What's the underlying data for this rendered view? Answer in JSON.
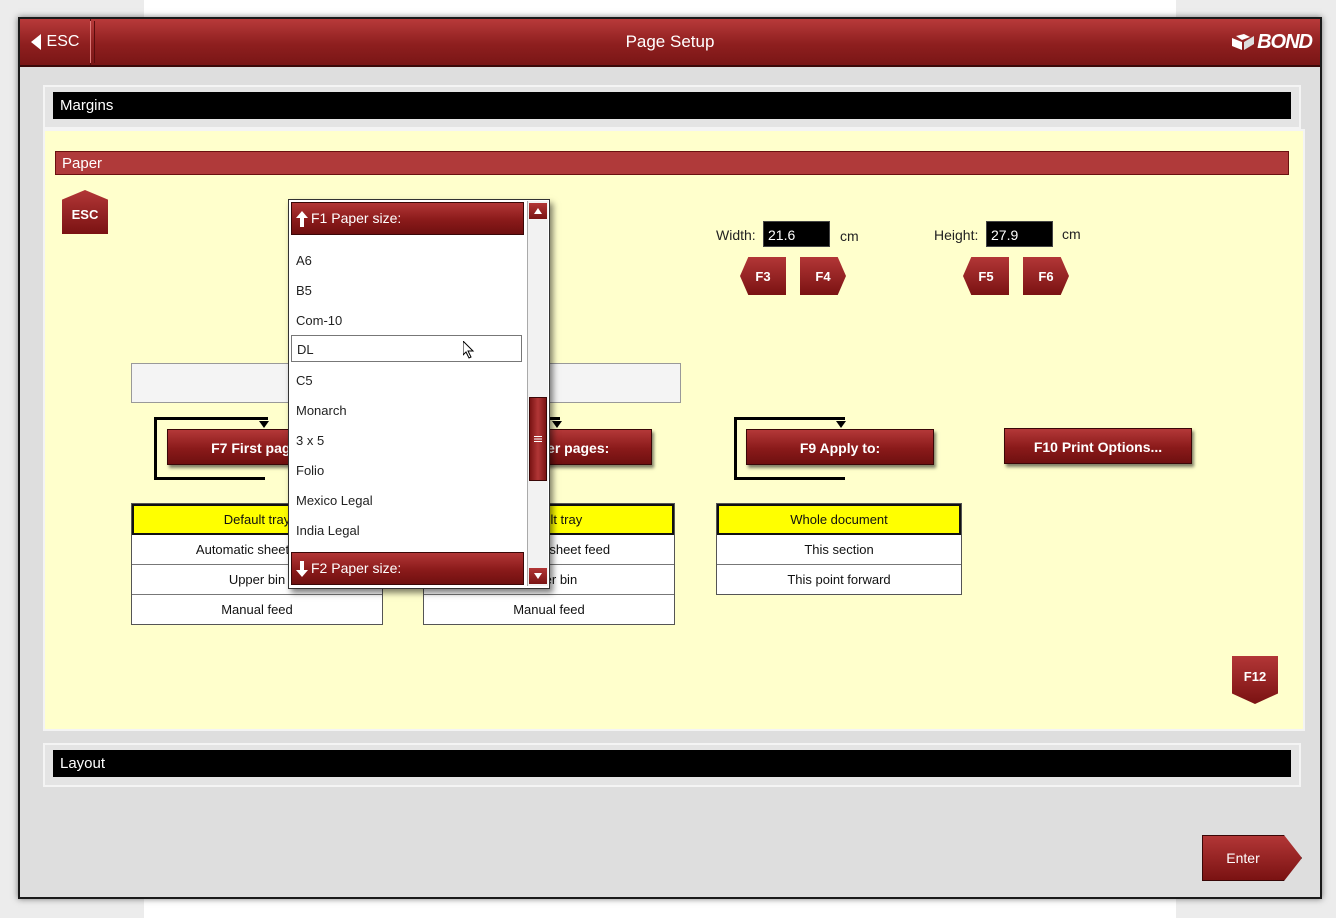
{
  "titlebar": {
    "esc_label": "ESC",
    "title": "Page Setup",
    "brand": "BOND"
  },
  "margins": {
    "title": "Margins"
  },
  "paper": {
    "title": "Paper",
    "esc_key": "ESC",
    "width_label": "Width:",
    "width_value": "21.6",
    "width_unit": "cm",
    "height_label": "Height:",
    "height_value": "27.9",
    "height_unit": "cm",
    "keys": {
      "f3": "F3",
      "f4": "F4",
      "f5": "F5",
      "f6": "F6",
      "f12": "F12"
    },
    "first_page_button": "F7 First page:",
    "other_pages_button": "F8 Other pages:",
    "apply_to_button": "F9 Apply to:",
    "print_options_button": "F10 Print Options...",
    "first_page_sources": [
      "Default tray",
      "Automatic sheet feed",
      "Upper bin",
      "Manual feed"
    ],
    "other_pages_sources": [
      "Default tray",
      "Automatic sheet feed",
      "Upper bin",
      "Manual feed"
    ],
    "apply_to_options": [
      "Whole document",
      "This section",
      "This point forward"
    ],
    "selected_source": "Default tray",
    "selected_apply_to": "Whole document"
  },
  "paper_size_dropdown": {
    "up_label": "F1 Paper size:",
    "down_label": "F2 Paper size:",
    "items": [
      "A6",
      "B5",
      "Com-10",
      "DL",
      "C5",
      "Monarch",
      "3 x 5",
      "Folio",
      "Mexico Legal",
      "India Legal"
    ],
    "highlighted": "DL"
  },
  "layout": {
    "title": "Layout"
  },
  "footer": {
    "enter_label": "Enter"
  },
  "colors": {
    "accent": "#8e1f1f",
    "panel_bg": "#ffffcc",
    "selected_bg": "#ffff00"
  }
}
